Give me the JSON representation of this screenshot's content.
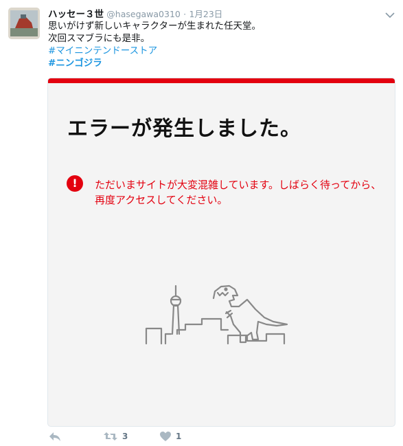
{
  "tweet": {
    "display_name": "ハッセー３世",
    "handle": "@hasegawa0310",
    "separator": "·",
    "timestamp": "1月23日",
    "text_lines": [
      "思いがけず新しいキャラクターが生まれた任天堂。",
      "次回スマブラにも是非。"
    ],
    "hashtags": [
      "#マイニンテンドーストア",
      "#ニンゴジラ"
    ],
    "card": {
      "title": "エラーが発生しました。",
      "message": "ただいまサイトが大変混雑しています。しばらく待ってから、再度アクセスしてください。",
      "icon_char": "!",
      "accent_color": "#e3000f"
    },
    "actions": {
      "reply_icon": "reply-icon",
      "retweet_count": "3",
      "like_count": "1"
    }
  }
}
